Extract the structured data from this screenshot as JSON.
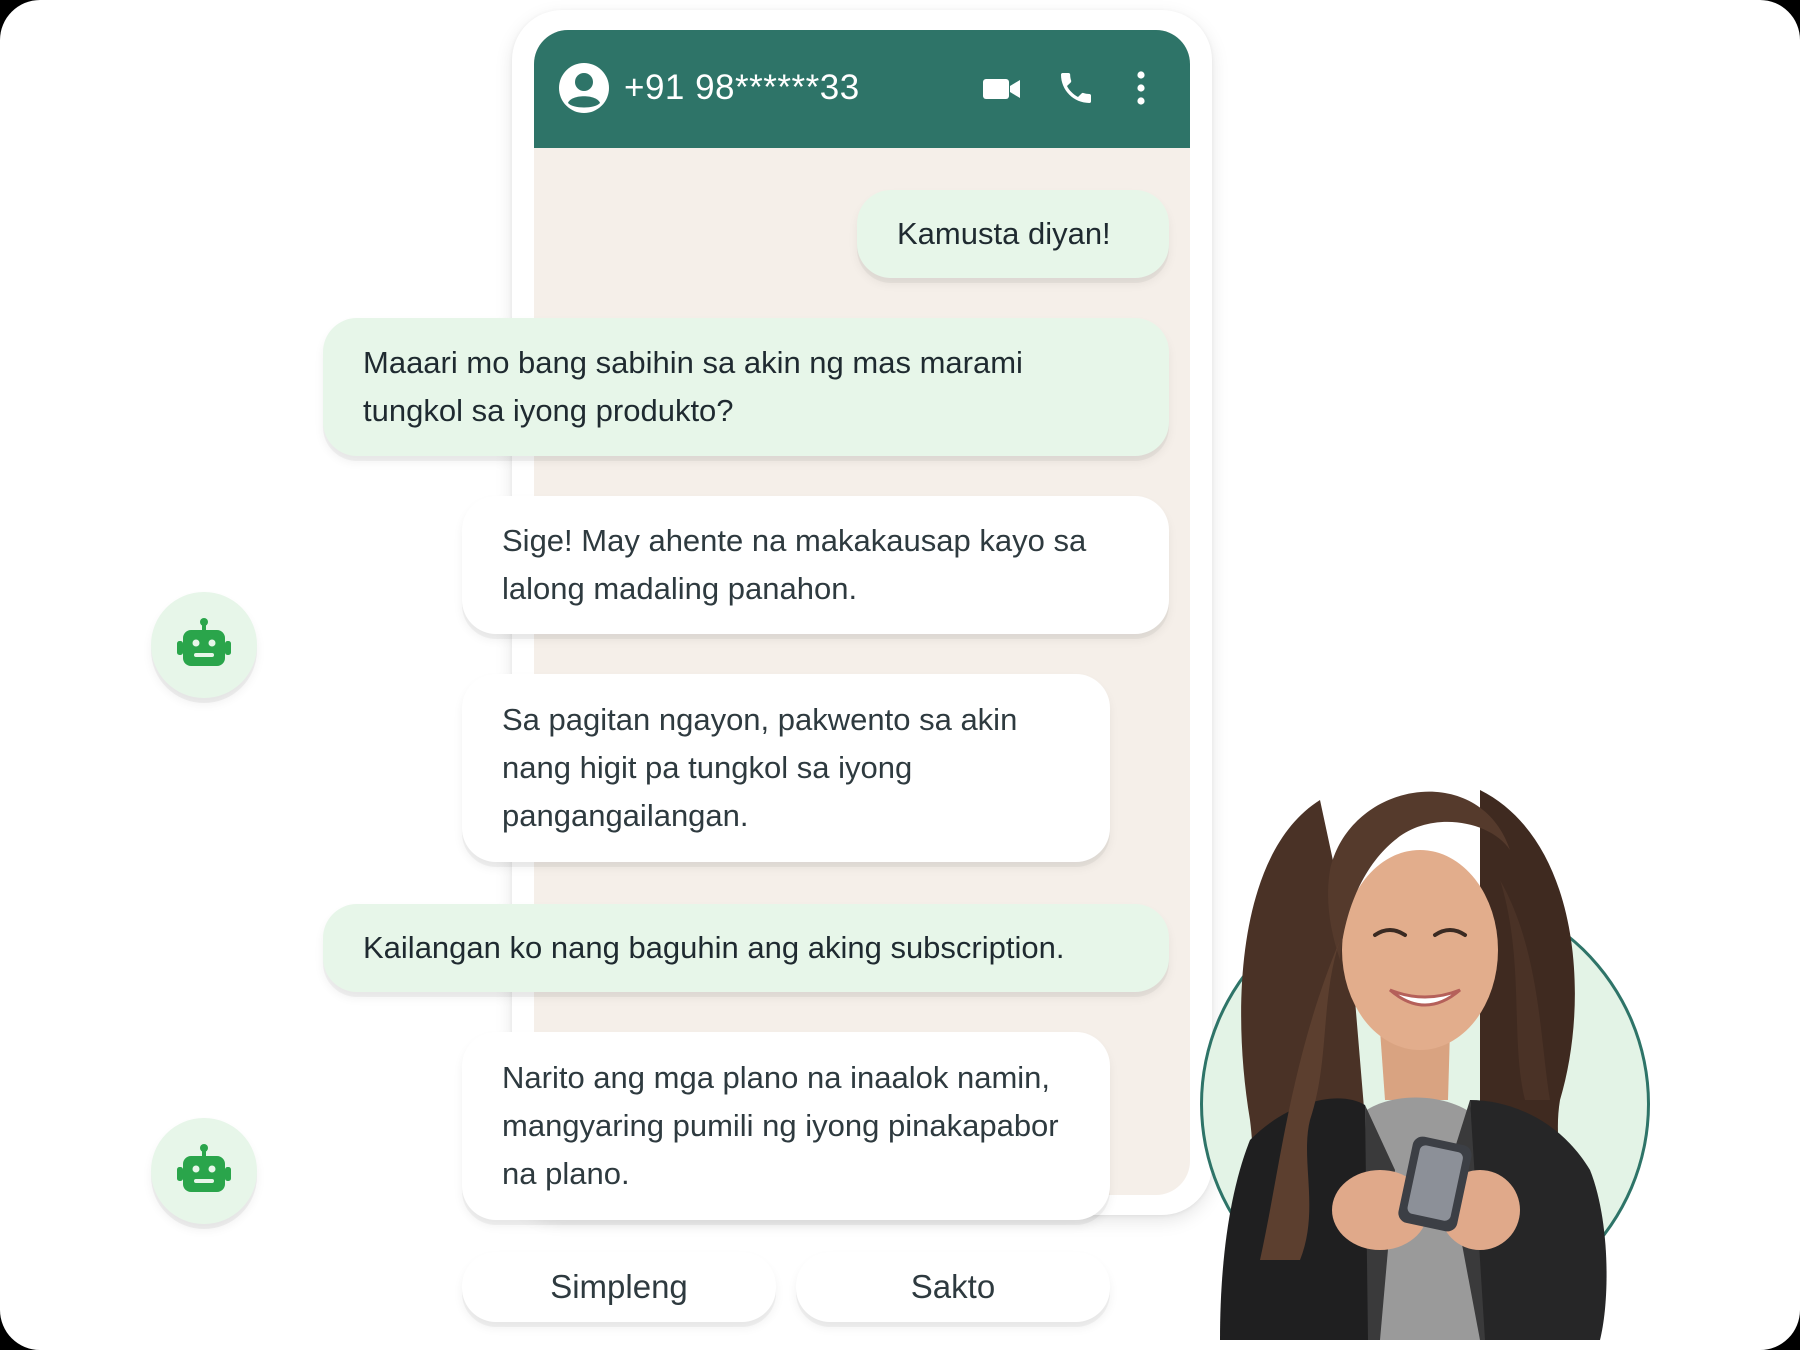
{
  "header": {
    "contact": "+91 98******33",
    "icons": [
      "avatar-icon",
      "video-call-icon",
      "phone-call-icon",
      "more-options-icon"
    ]
  },
  "messages": [
    {
      "sender": "user",
      "text": "Kamusta diyan!"
    },
    {
      "sender": "user",
      "text": "Maaari mo bang sabihin sa akin ng mas marami tungkol sa iyong produkto?"
    },
    {
      "sender": "bot",
      "text": "Sige! May ahente na makakausap kayo sa lalong madaling panahon."
    },
    {
      "sender": "bot",
      "text": "Sa pagitan ngayon, pakwento sa akin nang higit pa tungkol sa iyong pangangailangan."
    },
    {
      "sender": "user",
      "text": "Kailangan ko nang baguhin ang aking subscription."
    },
    {
      "sender": "bot",
      "text": "Narito ang mga plano na inaalok namin, mangyaring pumili ng iyong pinakapabor na plano."
    }
  ],
  "quick_replies": [
    "Simpleng",
    "Sakto"
  ],
  "colors": {
    "header": "#2e7468",
    "chat_background": "#f5efe9",
    "user_bubble": "#e7f6e9",
    "bot_bubble": "#ffffff",
    "bot_icon": "#2aa54b"
  }
}
